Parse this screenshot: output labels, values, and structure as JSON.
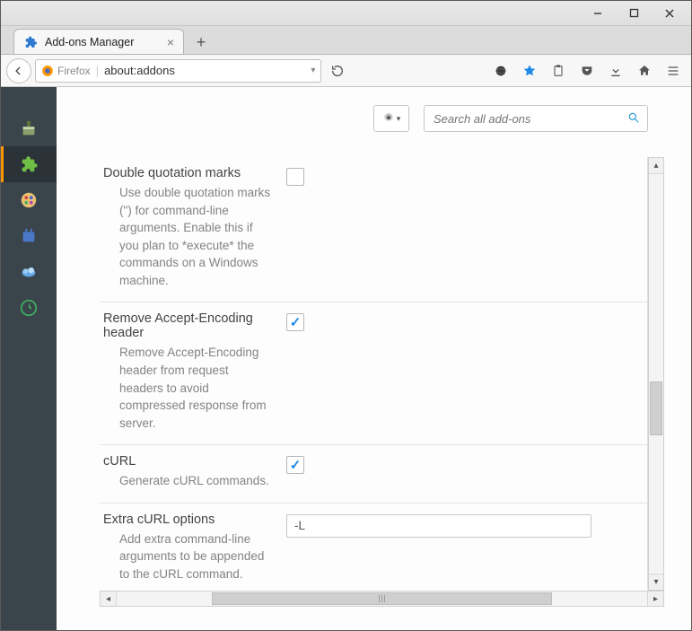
{
  "window": {
    "tab_title": "Add-ons Manager",
    "url_brand": "Firefox",
    "url_address": "about:addons"
  },
  "toolbar": {
    "search_placeholder": "Search all add-ons"
  },
  "prefs": [
    {
      "title": "Double quotation marks",
      "desc": "Use double quotation marks (\") for command-line arguments. Enable this if you plan to *execute* the commands on a Windows machine.",
      "type": "checkbox",
      "checked": false
    },
    {
      "title": "Remove Accept-Encoding header",
      "desc": "Remove Accept-Encoding header from request headers to avoid compressed response from server.",
      "type": "checkbox",
      "checked": true
    },
    {
      "title": "cURL",
      "desc": "Generate cURL commands.",
      "type": "checkbox",
      "checked": true
    },
    {
      "title": "Extra cURL options",
      "desc": "Add extra command-line arguments to be appended to the cURL command.",
      "type": "text",
      "value": "-L"
    }
  ]
}
